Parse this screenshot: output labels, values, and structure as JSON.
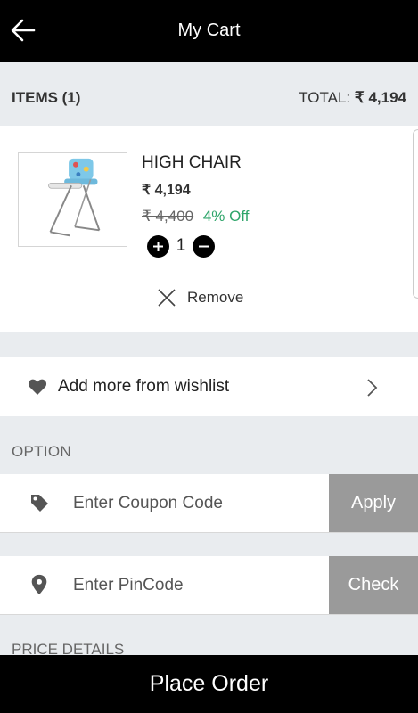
{
  "header": {
    "title": "My Cart",
    "back_icon": "arrow-left-icon"
  },
  "summary": {
    "items_label": "ITEMS (1)",
    "total_label": "TOTAL:",
    "total_value": "₹ 4,194"
  },
  "cart_items": [
    {
      "name": "HIGH CHAIR",
      "price": "₹ 4,194",
      "mrp": "₹ 4,400",
      "discount": "4% Off",
      "quantity": "1",
      "remove_label": "Remove"
    }
  ],
  "wishlist": {
    "label": "Add more from wishlist"
  },
  "option": {
    "title": "OPTION",
    "coupon": {
      "placeholder": "Enter Coupon Code",
      "value": "",
      "button": "Apply"
    },
    "pincode": {
      "placeholder": "Enter PinCode",
      "value": "",
      "button": "Check"
    }
  },
  "price_details": {
    "title": "PRICE DETAILS"
  },
  "footer": {
    "place_order_label": "Place Order"
  },
  "colors": {
    "header_bg": "#000000",
    "discount_green": "#2ea56a",
    "button_gray": "#9a9a9a",
    "page_bg": "#e9ecef"
  }
}
